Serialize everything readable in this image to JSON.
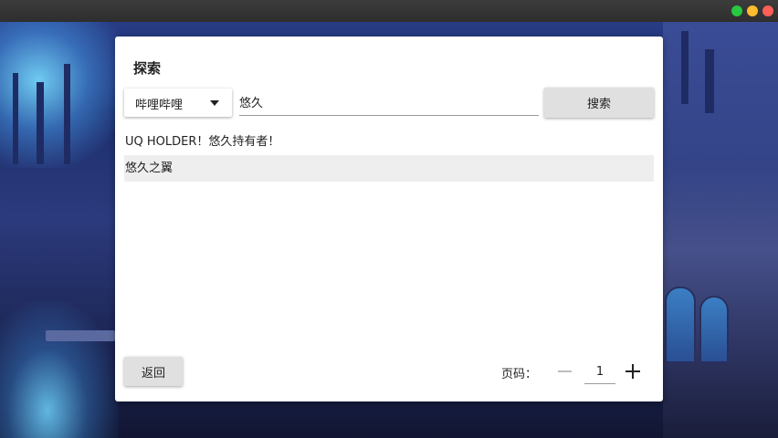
{
  "window": {
    "traffic_lights": [
      "#28c840",
      "#febc2e",
      "#ff5f57"
    ]
  },
  "dialog": {
    "title": "探索",
    "source_select": {
      "value": "哔哩哔哩"
    },
    "search_input": {
      "value": "悠久",
      "placeholder": ""
    },
    "search_button_label": "搜索",
    "results": [
      {
        "title": "UQ HOLDER！悠久持有者！",
        "selected": false
      },
      {
        "title": "悠久之翼",
        "selected": true
      }
    ],
    "back_button_label": "返回",
    "pagination": {
      "label": "页码：",
      "current_page": "1"
    }
  }
}
